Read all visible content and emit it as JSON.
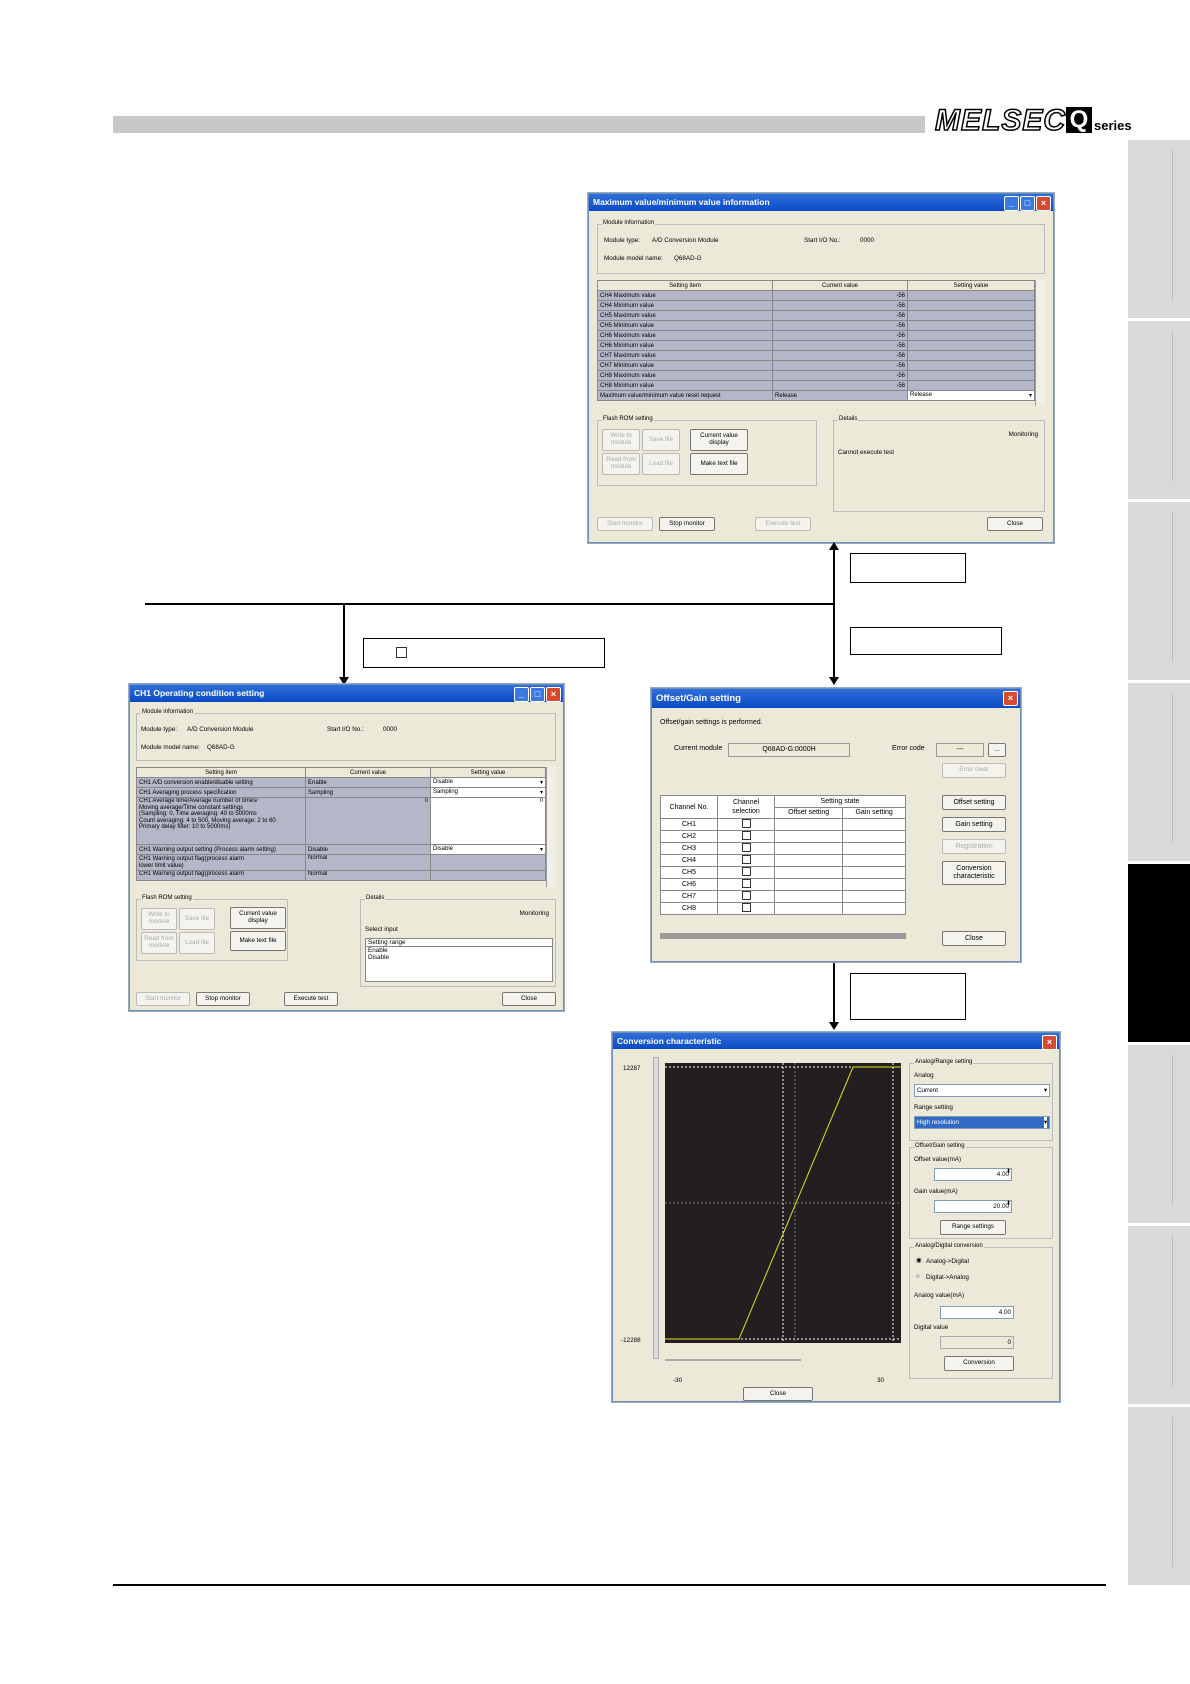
{
  "header": {
    "logo_text": "MELSEC",
    "logo_q": "Q",
    "logo_series": "series"
  },
  "maxmin": {
    "title": "Maximum value/minimum value information",
    "module_info_label": "Module information",
    "module_type_label": "Module type:",
    "module_type": "A/D Conversion Module",
    "start_io_label": "Start I/O No.:",
    "start_io": "0000",
    "model_label": "Module model name:",
    "model": "Q68AD-G",
    "headers": [
      "Setting item",
      "Current value",
      "Setting value"
    ],
    "rows": [
      {
        "item": "CH4 Maximum value",
        "cur": "-56",
        "set": ""
      },
      {
        "item": "CH4 Minimum value",
        "cur": "-56",
        "set": ""
      },
      {
        "item": "CH5 Maximum value",
        "cur": "-56",
        "set": ""
      },
      {
        "item": "CH5 Minimum value",
        "cur": "-56",
        "set": ""
      },
      {
        "item": "CH6 Maximum value",
        "cur": "-56",
        "set": ""
      },
      {
        "item": "CH6 Minimum value",
        "cur": "-56",
        "set": ""
      },
      {
        "item": "CH7 Maximum value",
        "cur": "-56",
        "set": ""
      },
      {
        "item": "CH7 Minimum value",
        "cur": "-56",
        "set": ""
      },
      {
        "item": "CH8 Maximum value",
        "cur": "-56",
        "set": ""
      },
      {
        "item": "CH8 Minimum value",
        "cur": "-56",
        "set": ""
      },
      {
        "item": "Maximum value/minimum value reset request",
        "cur": "Release",
        "set": "Release"
      }
    ],
    "flash_label": "Flash ROM setting",
    "write_module": "Write to module",
    "save_file": "Save file",
    "read_module": "Read from module",
    "load_file": "Load file",
    "current_display": "Current value display",
    "make_text": "Make text file",
    "details_label": "Details",
    "monitoring": "Monitoring",
    "cannot_execute": "Cannot execute test",
    "start_monitor": "Start monitor",
    "stop_monitor": "Stop monitor",
    "execute_test": "Execute test",
    "close": "Close"
  },
  "ch1": {
    "title": "CH1 Operating condition setting",
    "module_info_label": "Module information",
    "module_type_label": "Module type:",
    "module_type": "A/D Conversion Module",
    "start_io_label": "Start I/O No.:",
    "start_io": "0000",
    "model_label": "Module model name:",
    "model": "Q68AD-G",
    "headers": [
      "Setting item",
      "Current value",
      "Setting value"
    ],
    "r1": {
      "item": "CH1 A/D conversion enable/disable setting",
      "cur": "Enable",
      "set": "Disable"
    },
    "r2": {
      "item": "CH1 Averaging process specification",
      "cur": "Sampling",
      "set": "Sampling"
    },
    "r3_lines": [
      "CH1 Average time/Average number of times/",
      "Moving average/Time constant settings",
      "(Sampling: 0, Time averaging: 40 to 5000ms",
      "Count averaging: 4 to 500, Moving average: 2 to 60",
      "Primary delay filter: 10 to 5000ms)"
    ],
    "r3": {
      "cur": "0",
      "set": "0"
    },
    "r4": {
      "item": "CH1 Warning output setting (Process alarm setting)",
      "cur": "Disable",
      "set": "Disable"
    },
    "r5": {
      "item1": "CH1 Warning output flag(process alarm",
      "item2": "lower limit value)",
      "cur": "Normal"
    },
    "r6": {
      "item1": "CH1 Warning output flag(process alarm",
      "item2": "upper limit value)",
      "cur": "Normal"
    },
    "flash_label": "Flash ROM setting",
    "write_module": "Write to module",
    "save_file": "Save file",
    "read_module": "Read from module",
    "load_file": "Load file",
    "current_display": "Current value display",
    "make_text": "Make text file",
    "details_label": "Details",
    "monitoring": "Monitoring",
    "select_input": "Select input",
    "range_header": "Setting range",
    "range_items": [
      "Enable",
      "Disable"
    ],
    "start_monitor": "Start monitor",
    "stop_monitor": "Stop monitor",
    "execute_test": "Execute test",
    "close": "Close"
  },
  "offset": {
    "title": "Offset/Gain setting",
    "message": "Offset/gain settings is performed.",
    "current_module_label": "Current module",
    "current_module": "Q68AD-G:0000H",
    "error_code_label": "Error code",
    "error_code": "---",
    "ellipsis": "...",
    "error_clear": "Error clear",
    "col_channel": "Channel No.",
    "col_selection_1": "Channel",
    "col_selection_2": "selection",
    "col_state": "Setting state",
    "col_offset": "Offset setting",
    "col_gain": "Gain setting",
    "channels": [
      "CH1",
      "CH2",
      "CH3",
      "CH4",
      "CH5",
      "CH6",
      "CH7",
      "CH8"
    ],
    "btn_offset": "Offset setting",
    "btn_gain": "Gain setting",
    "btn_registration": "Registration",
    "btn_conversion_1": "Conversion",
    "btn_conversion_2": "characteristic",
    "btn_close": "Close"
  },
  "conv": {
    "title": "Conversion characteristic",
    "y_max": "12287",
    "y_min": "-12288",
    "x_min": "-30",
    "x_max": "30",
    "close": "Close",
    "analog_range_label": "Analog/Range setting",
    "analog_label": "Analog",
    "analog_value": "Current",
    "range_label": "Range setting",
    "range_value": "High resolution",
    "og_label": "Offset/Gain setting",
    "offset_label": "Offset value(mA)",
    "offset_value": "4.00",
    "gain_label": "Gain value(mA)",
    "gain_value": "20.00",
    "range_settings": "Range settings",
    "adc_label": "Analog/Digital conversion",
    "radio1": "Analog->Digital",
    "radio2": "Digital->Analog",
    "analog_value_label": "Analog value(mA)",
    "analog_input": "4.00",
    "digital_label": "Digital value",
    "digital_value": "0",
    "conversion": "Conversion"
  },
  "callouts": {
    "c1": "",
    "c2": "",
    "c3": "",
    "c4": "",
    "c5": ""
  }
}
